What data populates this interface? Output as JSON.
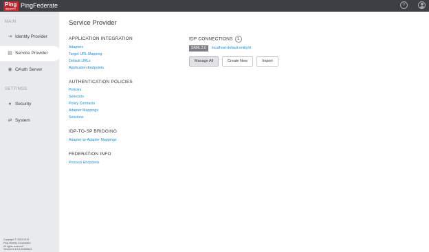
{
  "app": {
    "logo_brand": "Ping",
    "logo_sub": "IDENTITY",
    "product_name": "PingFederate",
    "help_icon": "help-icon",
    "user_icon": "user-icon"
  },
  "sidebar": {
    "main_label": "MAIN",
    "settings_label": "SETTINGS",
    "items": [
      {
        "label": "Identity Provider",
        "icon": "identity-provider-icon",
        "active": false
      },
      {
        "label": "Service Provider",
        "icon": "service-provider-icon",
        "active": true
      },
      {
        "label": "OAuth Server",
        "icon": "oauth-icon",
        "active": false
      },
      {
        "label": "Security",
        "icon": "security-icon",
        "active": false
      },
      {
        "label": "System",
        "icon": "system-icon",
        "active": false
      }
    ],
    "copyright": [
      "Copyright © 2003-2019",
      "Ping Identity Corporation",
      "All rights reserved",
      "Version 9.3.0.5-09408943"
    ]
  },
  "main": {
    "title": "Service Provider",
    "sections": [
      {
        "heading": "APPLICATION INTEGRATION",
        "links": [
          "Adapters",
          "Target URL Mapping",
          "Default URLs",
          "Application Endpoints"
        ]
      },
      {
        "heading": "AUTHENTICATION POLICIES",
        "links": [
          "Policies",
          "Selectors",
          "Policy Contracts",
          "Adapter Mappings",
          "Sessions"
        ]
      },
      {
        "heading": "IDP-TO-SP BRIDGING",
        "links": [
          "Adapter-to-Adapter Mappings"
        ]
      },
      {
        "heading": "FEDERATION INFO",
        "links": [
          "Protocol Endpoints"
        ]
      }
    ],
    "idp_connections": {
      "heading": "IDP CONNECTIONS",
      "count": "1",
      "protocol_tag": "SAML 2.0",
      "entity_id": "localhost:default:entityId",
      "buttons": {
        "manage_all": "Manage All",
        "create_new": "Create New",
        "import": "Import"
      }
    }
  },
  "colors": {
    "topbar": "#3d3f44",
    "brand": "#c1272d",
    "sidebar": "#e9eaec",
    "link": "#1a8dd6"
  }
}
